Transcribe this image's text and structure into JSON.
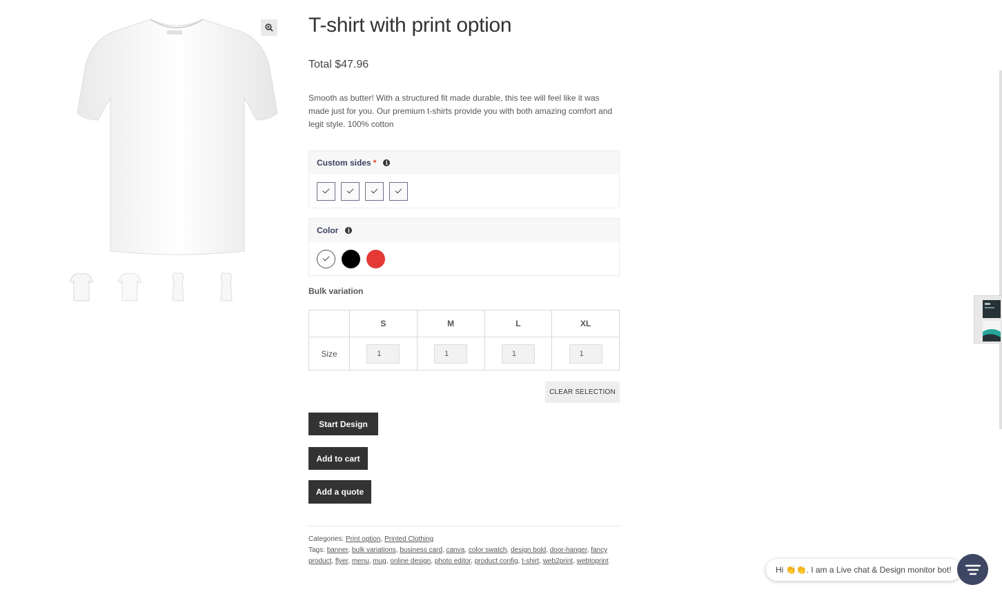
{
  "product": {
    "title": "T-shirt with print option",
    "price": "Total $47.96",
    "description": "Smooth as butter! With a structured fit made durable, this tee will feel like it was made just for you. Our premium t-shirts provide you with both amazing comfort and legit style. 100% cotton"
  },
  "gallery": {
    "zoom_icon": "zoom-in-icon",
    "thumbnails": [
      "front",
      "back",
      "left-side",
      "right-side"
    ]
  },
  "options": {
    "custom_sides": {
      "label": "Custom sides",
      "required_mark": "*",
      "info_icon": "info-icon",
      "swatch_count": 4
    },
    "color": {
      "label": "Color",
      "info_icon": "info-icon",
      "swatches": [
        "#ffffff",
        "#000000",
        "#e53935"
      ]
    }
  },
  "bulk": {
    "label": "Bulk variation",
    "row_label": "Size",
    "sizes": [
      "S",
      "M",
      "L",
      "XL"
    ],
    "quantities": [
      "1",
      "1",
      "1",
      "1"
    ]
  },
  "buttons": {
    "clear_selection": "CLEAR SELECTION",
    "start_design": "Start Design",
    "add_to_cart": "Add to cart",
    "add_quote": "Add a quote"
  },
  "meta": {
    "categories_label": "Categories:",
    "categories": [
      "Print option",
      "Printed Clothing"
    ],
    "tags_label": "Tags:",
    "tags": [
      "banner",
      "bulk variations",
      "business card",
      "canva",
      "color swatch",
      "design bold",
      "door-hanger",
      "fancy product",
      "flyer",
      "menu",
      "mug",
      "online design",
      "photo editor",
      "product config",
      "t-shirt",
      "web2print",
      "webtoprint"
    ]
  },
  "chat": {
    "message": "Hi 👏👏. I am a Live chat & Design monitor bot!"
  }
}
